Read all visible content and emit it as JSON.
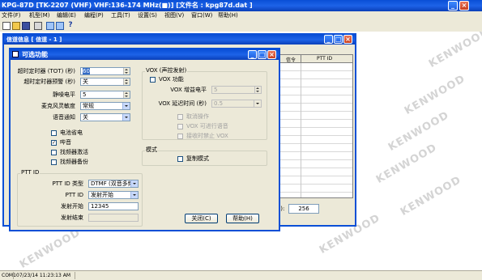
{
  "app": {
    "title": "KPG-87D [TK-2207 (VHF) VHF:136-174 MHz(■)] [文件名 : kpg87d.dat ]"
  },
  "menu": [
    "文件(F)",
    "机型(M)",
    "编辑(E)",
    "编程(P)",
    "工具(T)",
    "设置(S)",
    "视图(V)",
    "窗口(W)",
    "帮助(H)"
  ],
  "toolbar_icons": [
    "new-icon",
    "open-icon",
    "save-icon",
    "print-icon",
    "read-icon",
    "write-icon",
    "help-icon"
  ],
  "channel_window": {
    "title": "信道信息 [ 信道 - 1 ]",
    "col_partial": "信令",
    "col_ptt": "PTT ID",
    "right_value": "256",
    "right_label_fragment": "a):"
  },
  "dialog": {
    "title": "可选功能",
    "tot_label": "超时定时器 (TOT) (秒)",
    "tot_value": "60",
    "tot_prealert_label": "超时定时器预警 (秒)",
    "tot_prealert_value": "关",
    "squelch_label": "静噪电平",
    "squelch_value": "5",
    "mic_label": "麦克风灵敏度",
    "mic_value": "常规",
    "voice_label": "语音通知",
    "voice_value": "关",
    "battery_save_label": "电池省电",
    "battery_save_checked": false,
    "beep_label": "哔音",
    "beep_checked": true,
    "finder_activate_label": "找频器激活",
    "finder_activate_checked": false,
    "finder_backup_label": "找频器备份",
    "finder_backup_checked": false,
    "vox_group": "VOX (声控发射)",
    "vox_enable_label": "VOX 功能",
    "vox_gain_label": "VOX 增益电平",
    "vox_gain_value": "5",
    "vox_delay_label": "VOX 延迟时间 (秒)",
    "vox_delay_value": "0.5",
    "vox_cancel_label": "取消操作",
    "vox_talk_label": "VOX 可进行语音",
    "vox_rx_label": "接收时禁止 VOX",
    "mode_group": "模式",
    "clone_label": "复制模式",
    "ptt_group": "PTT ID",
    "ptt_type_label": "PTT ID 类型",
    "ptt_type_value": "DTMF (双音多频)",
    "ptt_id_label": "PTT ID",
    "ptt_id_value": "发射开始",
    "ptt_begin_label": "发射开始",
    "ptt_begin_value": "12345",
    "ptt_end_label": "发射结束",
    "ptt_end_value": "",
    "close_button": "关闭(C)",
    "help_button": "帮助(H)"
  },
  "status": {
    "port": "COM1",
    "datetime": "07/23/14 11:23:13 AM"
  },
  "watermark": "KENWOOD",
  "colors": {
    "titlebar": "#0a4fd6",
    "dialog_bg": "#ece9d8",
    "mdi_bg": "#808080",
    "window_bg": "#ffffff"
  }
}
